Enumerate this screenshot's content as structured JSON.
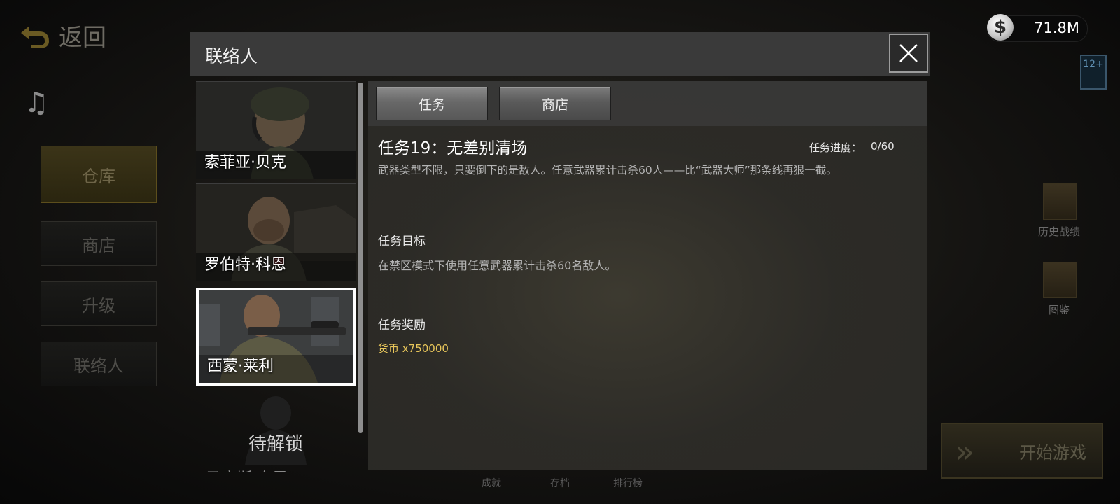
{
  "background": {
    "back_label": "返回",
    "side_menu": [
      "仓库",
      "商店",
      "升级",
      "联络人"
    ],
    "currency": {
      "symbol": "$",
      "value": "71.8M"
    },
    "age_rating": "12+",
    "right_items": [
      "历史战绩",
      "图鉴"
    ],
    "start_button": "开始游戏",
    "bottom_tabs": [
      "成就",
      "存档",
      "排行榜"
    ]
  },
  "modal": {
    "title": "联络人",
    "contacts": [
      {
        "name": "索菲亚·贝克",
        "selected": false
      },
      {
        "name": "罗伯特·科恩",
        "selected": false
      },
      {
        "name": "西蒙·莱利",
        "selected": true
      }
    ],
    "locked": {
      "label": "待解锁",
      "next_name": "马库斯·泰恩"
    },
    "tabs": [
      "任务",
      "商店"
    ],
    "active_tab": "任务",
    "mission": {
      "title": "任务19：无差别清场",
      "progress_label": "任务进度：",
      "progress_value": "0/60",
      "description": "武器类型不限，只要倒下的是敌人。任意武器累计击杀60人——比“武器大师”那条线再狠一截。",
      "objective_heading": "任务目标",
      "objective": "在禁区模式下使用任意武器累计击杀60名敌人。",
      "reward_heading": "任务奖励",
      "reward": "货币 x750000"
    }
  },
  "colors": {
    "reward": "#e8c65a",
    "header_bg": "#3a3a3a",
    "panel_bg": "#2f2e2b"
  }
}
